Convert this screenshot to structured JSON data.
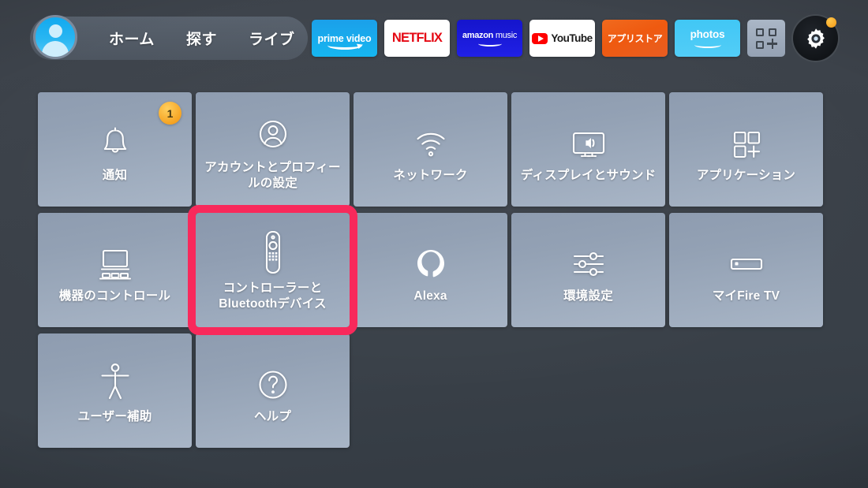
{
  "nav": {
    "avatar": "profile-avatar",
    "links": [
      {
        "label": "ホーム"
      },
      {
        "label": "探す"
      },
      {
        "label": "ライブ"
      }
    ],
    "apps": [
      {
        "name": "prime-video",
        "label": "prime video"
      },
      {
        "name": "netflix",
        "label": "NETFLIX"
      },
      {
        "name": "amazon-music",
        "label_bold": "amazon",
        "label_light": "music"
      },
      {
        "name": "youtube",
        "label": "YouTube"
      },
      {
        "name": "appstore",
        "label": "アプリストア"
      },
      {
        "name": "photos",
        "label": "photos"
      }
    ],
    "app_grid_label": "app-grid-icon",
    "settings_gear_label": "gear-icon",
    "settings_has_notification": true
  },
  "settings": {
    "tiles": [
      {
        "label": "通知",
        "icon": "bell-icon",
        "badge": "1",
        "selected": false
      },
      {
        "label": "アカウントとプロフィールの設定",
        "icon": "person-circle-icon",
        "badge": null,
        "selected": false
      },
      {
        "label": "ネットワーク",
        "icon": "wifi-icon",
        "badge": null,
        "selected": false
      },
      {
        "label": "ディスプレイとサウンド",
        "icon": "tv-sound-icon",
        "badge": null,
        "selected": false
      },
      {
        "label": "アプリケーション",
        "icon": "app-grid-plus-icon",
        "badge": null,
        "selected": false
      },
      {
        "label": "機器のコントロール",
        "icon": "device-control-icon",
        "badge": null,
        "selected": false
      },
      {
        "label": "コントローラーとBluetoothデバイス",
        "icon": "remote-control-icon",
        "badge": null,
        "selected": true
      },
      {
        "label": "Alexa",
        "icon": "alexa-ring-icon",
        "badge": null,
        "selected": false
      },
      {
        "label": "環境設定",
        "icon": "sliders-icon",
        "badge": null,
        "selected": false
      },
      {
        "label": "マイFire TV",
        "icon": "firetv-stick-icon",
        "badge": null,
        "selected": false
      },
      {
        "label": "ユーザー補助",
        "icon": "accessibility-icon",
        "badge": null,
        "selected": false
      },
      {
        "label": "ヘルプ",
        "icon": "question-circle-icon",
        "badge": null,
        "selected": false
      }
    ]
  },
  "colors": {
    "background": "#3b4149",
    "tile": "#98a6ba",
    "selection": "#f8295b",
    "badge": "#f59f1c",
    "prime_video": "#16b6f0",
    "netflix_red": "#e50914",
    "amazon_music": "#1f1fdd",
    "appstore_orange": "#ef5a10",
    "photos_blue": "#49caf6",
    "youtube_red": "#ff0000"
  }
}
